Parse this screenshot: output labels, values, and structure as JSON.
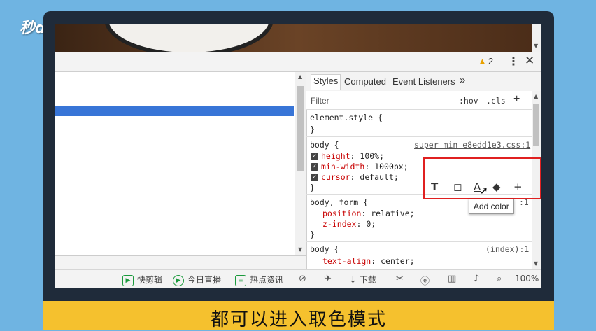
{
  "watermark": "秒dǒng视频",
  "devtools": {
    "warning_count": "2",
    "tabs": [
      "Styles",
      "Computed",
      "Event Listeners",
      "»"
    ],
    "filter_placeholder": "Filter",
    "filter_hov": ":hov",
    "filter_cls": ".cls",
    "filter_add": "+",
    "rules": {
      "element_style": "element.style {",
      "close": "}",
      "body1_selector": "body {",
      "body1_source": "super min e8edd1e3.css:1",
      "body1_props": [
        {
          "name": "height",
          "value": "100%;"
        },
        {
          "name": "min-width",
          "value": "1000px;"
        },
        {
          "name": "cursor",
          "value": "default;"
        }
      ],
      "body2_selector": "body, form {",
      "body2_source": ":1",
      "body2_props": [
        {
          "name": "position",
          "value": "relative;"
        },
        {
          "name": "z-index",
          "value": "0;"
        }
      ],
      "body3_selector": "body {",
      "body3_source": "(index):1",
      "body3_props": [
        {
          "name": "text-align",
          "value": "center;"
        }
      ]
    },
    "popup_icons": [
      "text-shadow-icon",
      "box-shadow-icon",
      "color-icon",
      "background-color-icon",
      "add-icon"
    ],
    "tooltip": "Add color"
  },
  "statusbar": {
    "items": [
      "快剪辑",
      "今日直播",
      "热点资讯",
      "下载",
      "100%"
    ]
  },
  "subtitle": "都可以进入取色模式",
  "colors": {
    "selection": "#3875d7",
    "highlight_border": "#e02020",
    "subtitle_bg": "#f5c12e",
    "property": "#c80000"
  }
}
